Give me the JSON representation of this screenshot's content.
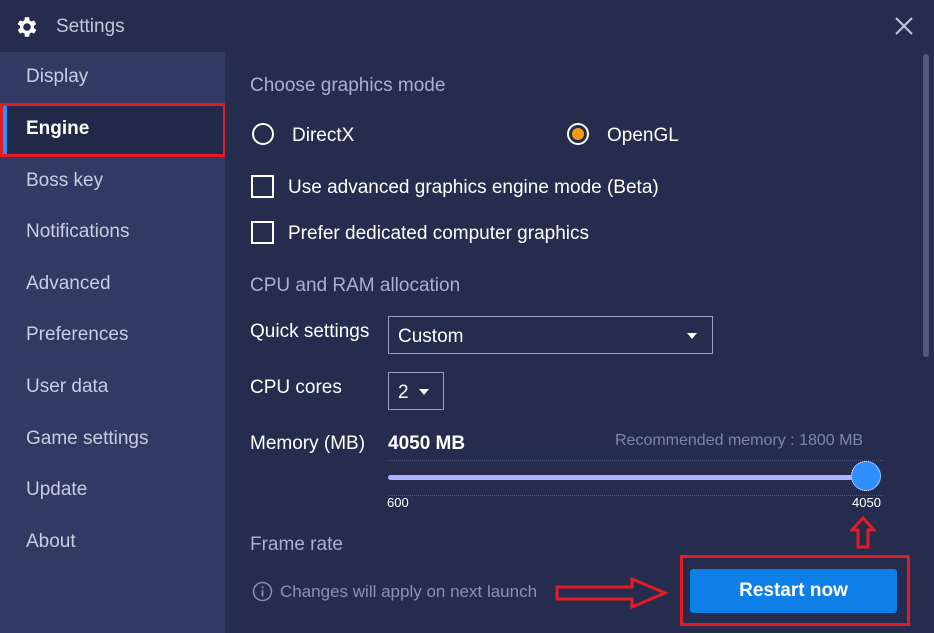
{
  "window": {
    "title": "Settings",
    "close_icon": "close-icon",
    "gear_icon": "gear-icon"
  },
  "sidebar": {
    "items": [
      {
        "label": "Display"
      },
      {
        "label": "Engine",
        "active": true
      },
      {
        "label": "Boss key"
      },
      {
        "label": "Notifications"
      },
      {
        "label": "Advanced"
      },
      {
        "label": "Preferences"
      },
      {
        "label": "User data"
      },
      {
        "label": "Game settings"
      },
      {
        "label": "Update"
      },
      {
        "label": "About"
      }
    ]
  },
  "graphics": {
    "title": "Choose graphics mode",
    "directx_label": "DirectX",
    "opengl_label": "OpenGL",
    "selected": "OpenGL",
    "advanced_mode_label": "Use advanced graphics engine mode (Beta)",
    "advanced_mode_checked": false,
    "dedicated_label": "Prefer dedicated computer graphics",
    "dedicated_checked": false
  },
  "allocation": {
    "title": "CPU and RAM allocation",
    "quick_label": "Quick settings",
    "quick_value": "Custom",
    "cpu_label": "CPU cores",
    "cpu_value": "2",
    "memory_label": "Memory (MB)",
    "memory_value": "4050 MB",
    "recommended": "Recommended memory : 1800 MB",
    "slider_min": "600",
    "slider_max": "4050",
    "slider_level": 1.0
  },
  "frame_rate": {
    "title": "Frame rate"
  },
  "footer": {
    "info_icon": "info-icon",
    "info_text": "Changes will apply on next launch",
    "restart_label": "Restart now"
  },
  "colors": {
    "background": "#262c4d",
    "sidebar": "#323a64",
    "accent": "#0f7fe8",
    "radio_selected": "#f39c12",
    "annotation": "#e31b23"
  }
}
